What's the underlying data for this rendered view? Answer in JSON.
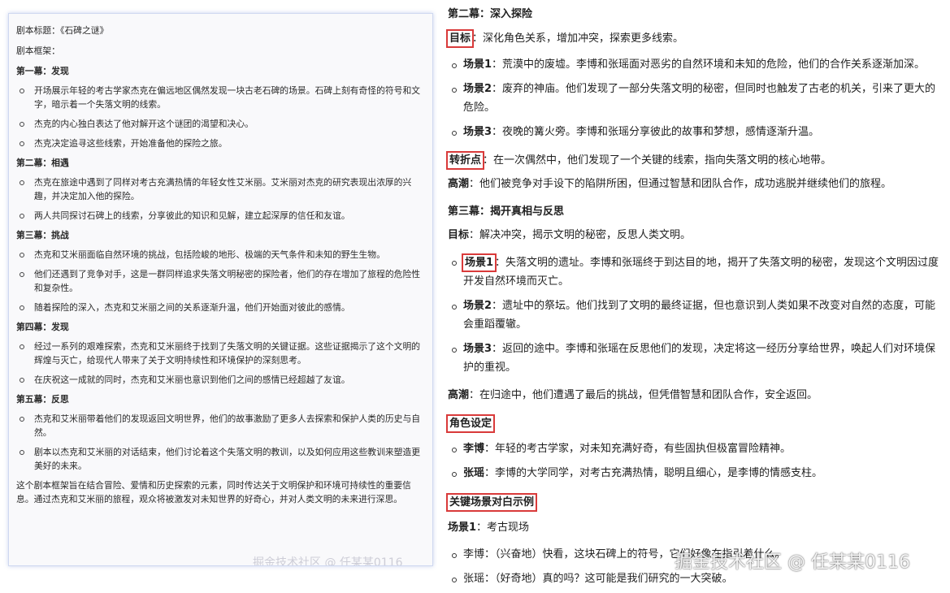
{
  "left": {
    "meta_title": "剧本标题：《石碑之谜》",
    "meta_frame": "剧本框架：",
    "acts": [
      {
        "title": "第一幕：发现",
        "items": [
          "开场展示年轻的考古学家杰克在偏远地区偶然发现一块古老石碑的场景。石碑上刻有奇怪的符号和文字，暗示着一个失落文明的线索。",
          "杰克的内心独白表达了他对解开这个谜团的渴望和决心。",
          "杰克决定追寻这些线索，开始准备他的探险之旅。"
        ]
      },
      {
        "title": "第二幕：相遇",
        "items": [
          "杰克在旅途中遇到了同样对考古充满热情的年轻女性艾米丽。艾米丽对杰克的研究表现出浓厚的兴趣，并决定加入他的探险。",
          "两人共同探讨石碑上的线索，分享彼此的知识和见解，建立起深厚的信任和友谊。"
        ]
      },
      {
        "title": "第三幕：挑战",
        "items": [
          "杰克和艾米丽面临自然环境的挑战，包括险峻的地形、极端的天气条件和未知的野生生物。",
          "他们还遇到了竞争对手，这是一群同样追求失落文明秘密的探险者，他们的存在增加了旅程的危险性和复杂性。",
          "随着探险的深入，杰克和艾米丽之间的关系逐渐升温，他们开始面对彼此的感情。"
        ]
      },
      {
        "title": "第四幕：发现",
        "items": [
          "经过一系列的艰难探索，杰克和艾米丽终于找到了失落文明的关键证据。这些证据揭示了这个文明的辉煌与灭亡，给现代人带来了关于文明持续性和环境保护的深刻思考。",
          "在庆祝这一成就的同时，杰克和艾米丽也意识到他们之间的感情已经超越了友谊。"
        ]
      },
      {
        "title": "第五幕：反思",
        "items": [
          "杰克和艾米丽带着他们的发现返回文明世界，他们的故事激励了更多人去探索和保护人类的历史与自然。",
          "剧本以杰克和艾米丽的对话结束，他们讨论着这个失落文明的教训，以及如何应用这些教训来塑造更美好的未来。"
        ]
      }
    ],
    "summary": "这个剧本框架旨在结合冒险、爱情和历史探索的元素，同时传达关于文明保护和环境可持续性的重要信息。通过杰克和艾米丽的旅程，观众将被激发对未知世界的好奇心，并对人类文明的未来进行深思。",
    "watermark": "掘金技术社区 @ 任某某0116"
  },
  "right": {
    "act2_title": "第二幕：深入探险",
    "act2_goal_label": "目标",
    "act2_goal_text": "：深化角色关系，增加冲突，探索更多线索。",
    "act2_scenes": [
      {
        "label": "场景1",
        "text": "：荒漠中的废墟。李博和张瑶面对恶劣的自然环境和未知的危险，他们的合作关系逐渐加深。"
      },
      {
        "label": "场景2",
        "text": "：废弃的神庙。他们发现了一部分失落文明的秘密，但同时也触发了古老的机关，引来了更大的危险。"
      },
      {
        "label": "场景3",
        "text": "：夜晚的篝火旁。李博和张瑶分享彼此的故事和梦想，感情逐渐升温。"
      }
    ],
    "turning_label": "转折点",
    "turning_text": "：在一次偶然中，他们发现了一个关键的线索，指向失落文明的核心地带。",
    "climax1_label": "高潮",
    "climax1_text": "：他们被竞争对手设下的陷阱所困，但通过智慧和团队合作，成功逃脱并继续他们的旅程。",
    "act3_title": "第三幕：揭开真相与反思",
    "act3_goal_label": "目标",
    "act3_goal_text": "：解决冲突，揭示文明的秘密，反思人类文明。",
    "act3_scenes": [
      {
        "label": "场景1",
        "text": "：失落文明的遗址。李博和张瑶终于到达目的地，揭开了失落文明的秘密，发现这个文明因过度开发自然环境而灭亡。"
      },
      {
        "label": "场景2",
        "text": "：遗址中的祭坛。他们找到了文明的最终证据，但也意识到人类如果不改变对自然的态度，可能会重蹈覆辙。"
      },
      {
        "label": "场景3",
        "text": "：返回的途中。李博和张瑶在反思他们的发现，决定将这一经历分享给世界，唤起人们对环境保护的重视。"
      }
    ],
    "climax2_label": "高潮",
    "climax2_text": "：在归途中，他们遭遇了最后的挑战，但凭借智慧和团队合作，安全返回。",
    "roles_title": "角色设定",
    "roles": [
      {
        "label": "李博",
        "text": "：年轻的考古学家，对未知充满好奇，有些固执但极富冒险精神。"
      },
      {
        "label": "张瑶",
        "text": "：李博的大学同学，对考古充满热情，聪明且细心，是李博的情感支柱。"
      }
    ],
    "dialogue_title": "关键场景对白示例",
    "dialogue_scene_label": "场景1",
    "dialogue_scene_text": "：考古现场",
    "dialogue": [
      "李博：（兴奋地）快看，这块石碑上的符号，它们好像在指引着什么。",
      "张瑶：（好奇地）真的吗？这可能是我们研究的一大突破。"
    ]
  },
  "watermark": "掘金技术社区 @ 任某某0116"
}
